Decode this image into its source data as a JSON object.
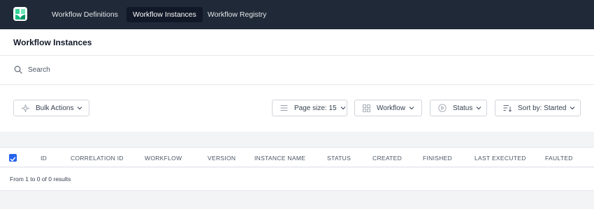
{
  "nav": {
    "items": [
      {
        "label": "Workflow Definitions"
      },
      {
        "label": "Workflow Instances"
      },
      {
        "label": "Workflow Registry"
      }
    ],
    "active_index": 1
  },
  "header": {
    "title": "Workflow Instances"
  },
  "search": {
    "placeholder": "Search",
    "value": ""
  },
  "toolbar": {
    "bulk_actions": "Bulk Actions",
    "page_size": "Page size: 15",
    "workflow": "Workflow",
    "status": "Status",
    "sort": "Sort by: Started"
  },
  "table": {
    "columns": [
      "ID",
      "CORRELATION ID",
      "WORKFLOW",
      "VERSION",
      "INSTANCE NAME",
      "STATUS",
      "CREATED",
      "FINISHED",
      "LAST EXECUTED",
      "FAULTED"
    ],
    "select_all_checked": true,
    "rows": []
  },
  "pagination": {
    "summary": "From 1 to 0 of 0 results"
  },
  "colors": {
    "nav_bg": "#1f2937",
    "accent": "#2563eb",
    "logo_green": "#34d399"
  }
}
